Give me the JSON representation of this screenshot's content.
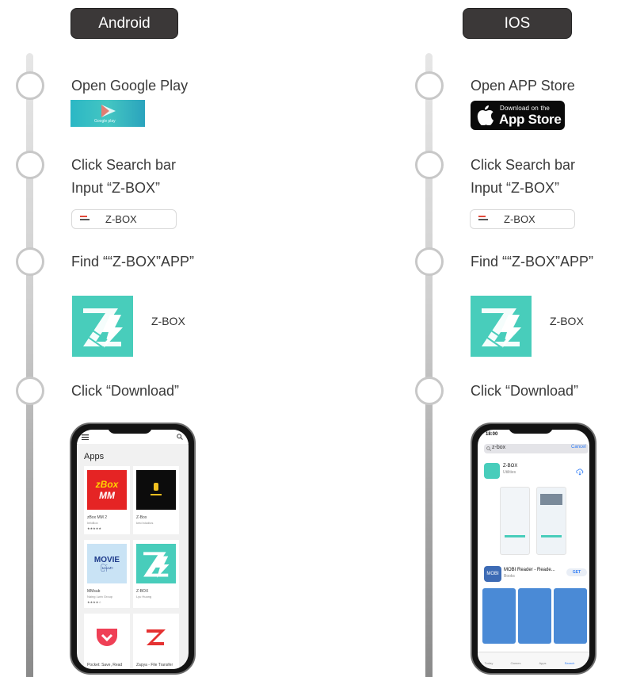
{
  "android": {
    "header": "Android",
    "steps": {
      "s1": "Open Google Play",
      "s2_line1": "Click Search bar",
      "s2_line2": "Input “Z-BOX”",
      "s3": "Find ““Z-BOX”APP”",
      "s4": "Click “Download”"
    },
    "store_badge_label": "Google play",
    "search_text": "Z-BOX",
    "app_name": "Z-BOX",
    "phone": {
      "section_title": "Apps",
      "cards": [
        {
          "line1": "zBox MM 2",
          "line2": "InfoBox",
          "rating": "★★★★★"
        },
        {
          "line1": "Z-Box",
          "line2": "kmd studios",
          "rating": ""
        },
        {
          "line1": "MMsub",
          "line2": "Naing Lwin Group",
          "rating": "★★★★☆"
        },
        {
          "line1": "Z-BOX",
          "line2": "Lyu Huang",
          "rating": ""
        },
        {
          "line1": "Pocket: Save, Read",
          "line2": "",
          "rating": ""
        },
        {
          "line1": "Zapya - File Transfer",
          "line2": "",
          "rating": ""
        }
      ],
      "zbox_red_line1": "zBox",
      "zbox_red_line2": "MM",
      "movie_line1": "MOVIE",
      "movie_line2": "မြန်မာ"
    }
  },
  "ios": {
    "header": "IOS",
    "steps": {
      "s1": "Open APP Store",
      "s2_line1": "Click Search bar",
      "s2_line2": "Input “Z-BOX”",
      "s3": "Find ““Z-BOX”APP”",
      "s4": "Click “Download”"
    },
    "badge_small": "Download on the",
    "badge_big": "App Store",
    "search_text": "Z-BOX",
    "app_name": "Z-BOX",
    "phone": {
      "time": "18:00",
      "query": "z-box",
      "cancel": "Cancel",
      "result1_name": "Z-BOX",
      "result1_sub": "Utilities",
      "result2_name": "MOBI Reader - Reade...",
      "result2_sub": "Books",
      "get_label": "GET",
      "tabs": [
        "Today",
        "Games",
        "Apps",
        "Search"
      ]
    }
  },
  "colors": {
    "header_bg": "#3b3838",
    "zbox_teal": "#48cdbb",
    "rail_light": "#e6e6e6",
    "rail_dark": "#8a8a8a"
  }
}
